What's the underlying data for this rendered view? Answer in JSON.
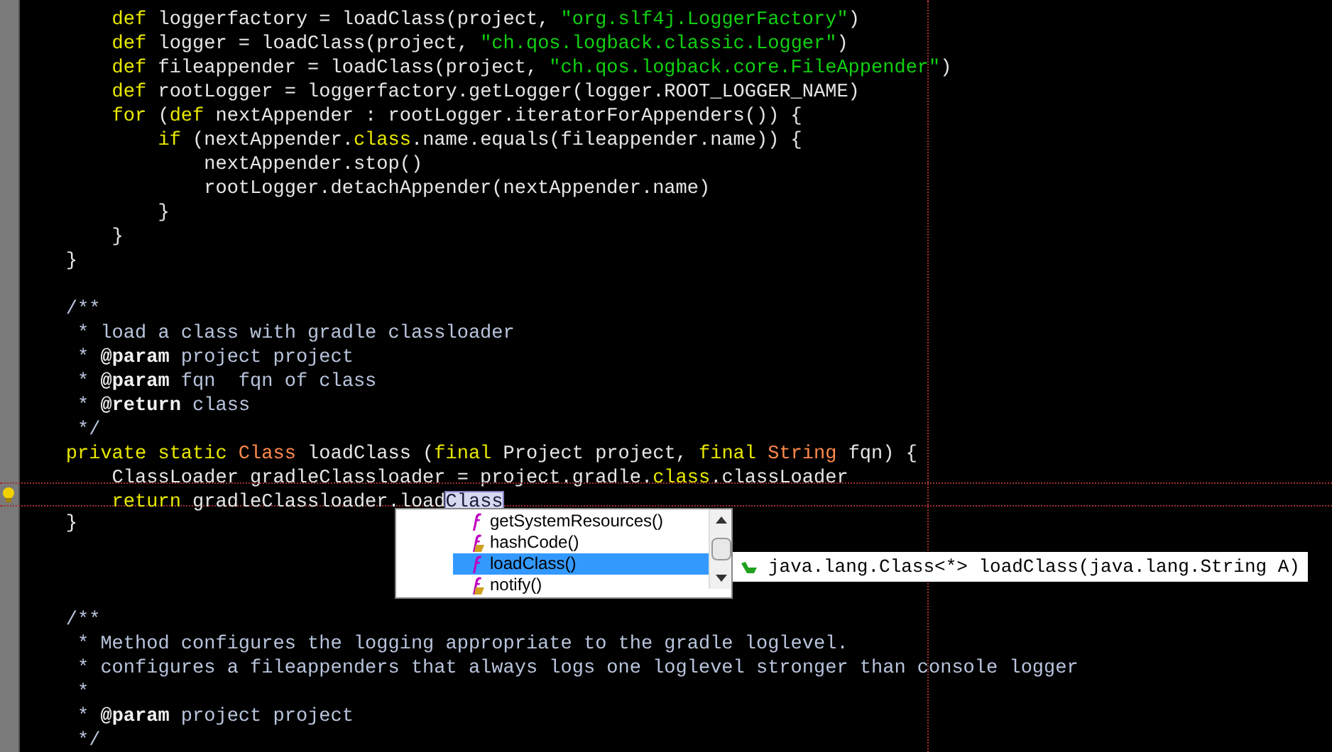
{
  "editor": {
    "lines": [
      {
        "kind": "code",
        "current": false,
        "segments": [
          {
            "kind": "keyword",
            "text": "        def"
          },
          {
            "kind": "plain",
            "text": " loggerfactory = loadClass(project, "
          },
          {
            "kind": "string",
            "text": "\"org.slf4j.LoggerFactory\""
          },
          {
            "kind": "plain",
            "text": ")"
          }
        ]
      },
      {
        "kind": "code",
        "current": false,
        "segments": [
          {
            "kind": "keyword",
            "text": "        def"
          },
          {
            "kind": "plain",
            "text": " logger = loadClass(project, "
          },
          {
            "kind": "string",
            "text": "\"ch.qos.logback.classic.Logger\""
          },
          {
            "kind": "plain",
            "text": ")"
          }
        ]
      },
      {
        "kind": "code",
        "current": false,
        "segments": [
          {
            "kind": "keyword",
            "text": "        def"
          },
          {
            "kind": "plain",
            "text": " fileappender = loadClass(project, "
          },
          {
            "kind": "string",
            "text": "\"ch.qos.logback.core.FileAppender\""
          },
          {
            "kind": "plain",
            "text": ")"
          }
        ]
      },
      {
        "kind": "code",
        "current": false,
        "segments": [
          {
            "kind": "keyword",
            "text": "        def"
          },
          {
            "kind": "plain",
            "text": " rootLogger = loggerfactory.getLogger(logger.ROOT_LOGGER_NAME)"
          }
        ]
      },
      {
        "kind": "code",
        "current": false,
        "segments": [
          {
            "kind": "keyword",
            "text": "        for"
          },
          {
            "kind": "plain",
            "text": " ("
          },
          {
            "kind": "keyword",
            "text": "def"
          },
          {
            "kind": "plain",
            "text": " nextAppender : rootLogger.iteratorForAppenders()) {"
          }
        ]
      },
      {
        "kind": "code",
        "current": false,
        "segments": [
          {
            "kind": "keyword",
            "text": "            if"
          },
          {
            "kind": "plain",
            "text": " (nextAppender."
          },
          {
            "kind": "keyword",
            "text": "class"
          },
          {
            "kind": "plain",
            "text": ".name.equals(fileappender.name)) {"
          }
        ]
      },
      {
        "kind": "code",
        "current": false,
        "segments": [
          {
            "kind": "plain",
            "text": "                nextAppender.stop()"
          }
        ]
      },
      {
        "kind": "code",
        "current": false,
        "segments": [
          {
            "kind": "plain",
            "text": "                rootLogger.detachAppender(nextAppender.name)"
          }
        ]
      },
      {
        "kind": "code",
        "current": false,
        "segments": [
          {
            "kind": "plain",
            "text": "            }"
          }
        ]
      },
      {
        "kind": "code",
        "current": false,
        "segments": [
          {
            "kind": "plain",
            "text": "        }"
          }
        ]
      },
      {
        "kind": "code",
        "current": false,
        "segments": [
          {
            "kind": "plain",
            "text": "    }"
          }
        ]
      },
      {
        "kind": "blank"
      },
      {
        "kind": "code",
        "current": false,
        "segments": [
          {
            "kind": "comment",
            "text": "    /**"
          }
        ]
      },
      {
        "kind": "code",
        "current": false,
        "segments": [
          {
            "kind": "comment",
            "text": "     * load a class with gradle classloader"
          }
        ]
      },
      {
        "kind": "code",
        "current": false,
        "segments": [
          {
            "kind": "comment",
            "text": "     * "
          },
          {
            "kind": "doctag",
            "text": "@param"
          },
          {
            "kind": "comment",
            "text": " project project"
          }
        ]
      },
      {
        "kind": "code",
        "current": false,
        "segments": [
          {
            "kind": "comment",
            "text": "     * "
          },
          {
            "kind": "doctag",
            "text": "@param"
          },
          {
            "kind": "comment",
            "text": " fqn  fqn of class"
          }
        ]
      },
      {
        "kind": "code",
        "current": false,
        "segments": [
          {
            "kind": "comment",
            "text": "     * "
          },
          {
            "kind": "doctag",
            "text": "@return"
          },
          {
            "kind": "comment",
            "text": " class"
          }
        ]
      },
      {
        "kind": "code",
        "current": false,
        "segments": [
          {
            "kind": "comment",
            "text": "     */"
          }
        ]
      },
      {
        "kind": "code",
        "current": false,
        "segments": [
          {
            "kind": "keyword",
            "text": "    private static"
          },
          {
            "kind": "type",
            "text": " Class"
          },
          {
            "kind": "plain",
            "text": " loadClass ("
          },
          {
            "kind": "keyword",
            "text": "final"
          },
          {
            "kind": "plain",
            "text": " Project project, "
          },
          {
            "kind": "keyword",
            "text": "final"
          },
          {
            "kind": "type",
            "text": " String"
          },
          {
            "kind": "plain",
            "text": " fqn) {"
          }
        ]
      },
      {
        "kind": "code",
        "current": false,
        "segments": [
          {
            "kind": "plain",
            "text": "        ClassLoader gradleClassloader = project.gradle."
          },
          {
            "kind": "keyword",
            "text": "class"
          },
          {
            "kind": "plain",
            "text": ".classLoader"
          }
        ]
      },
      {
        "kind": "code",
        "current": true,
        "segments": [
          {
            "kind": "keyword",
            "text": "        return"
          },
          {
            "kind": "plain",
            "text": " gradleClassloader.load"
          },
          {
            "kind": "selected",
            "text": "Class"
          }
        ]
      },
      {
        "kind": "code",
        "current": false,
        "segments": [
          {
            "kind": "plain",
            "text": "    }"
          }
        ]
      },
      {
        "kind": "blank"
      },
      {
        "kind": "blank"
      },
      {
        "kind": "blank"
      },
      {
        "kind": "code",
        "current": false,
        "segments": [
          {
            "kind": "comment",
            "text": "    /**"
          }
        ]
      },
      {
        "kind": "code",
        "current": false,
        "segments": [
          {
            "kind": "comment",
            "text": "     * Method configures the logging appropriate to the gradle loglevel."
          }
        ]
      },
      {
        "kind": "code",
        "current": false,
        "segments": [
          {
            "kind": "comment",
            "text": "     * configures a fileappenders that always logs one loglevel stronger than console logger"
          }
        ]
      },
      {
        "kind": "code",
        "current": false,
        "segments": [
          {
            "kind": "comment",
            "text": "     *"
          }
        ]
      },
      {
        "kind": "code",
        "current": false,
        "segments": [
          {
            "kind": "comment",
            "text": "     * "
          },
          {
            "kind": "doctag",
            "text": "@param"
          },
          {
            "kind": "comment",
            "text": " project project"
          }
        ]
      },
      {
        "kind": "code",
        "current": false,
        "segments": [
          {
            "kind": "comment",
            "text": "     */"
          }
        ]
      }
    ]
  },
  "completion": {
    "items": [
      {
        "label": "getSystemResources()",
        "kind": "method",
        "selected": false
      },
      {
        "label": "hashCode()",
        "kind": "inherited",
        "selected": false
      },
      {
        "label": "loadClass()",
        "kind": "method",
        "selected": true
      },
      {
        "label": "notify()",
        "kind": "inherited",
        "selected": false
      }
    ]
  },
  "tooltip": {
    "text": "java.lang.Class<*> loadClass(java.lang.String A)"
  }
}
